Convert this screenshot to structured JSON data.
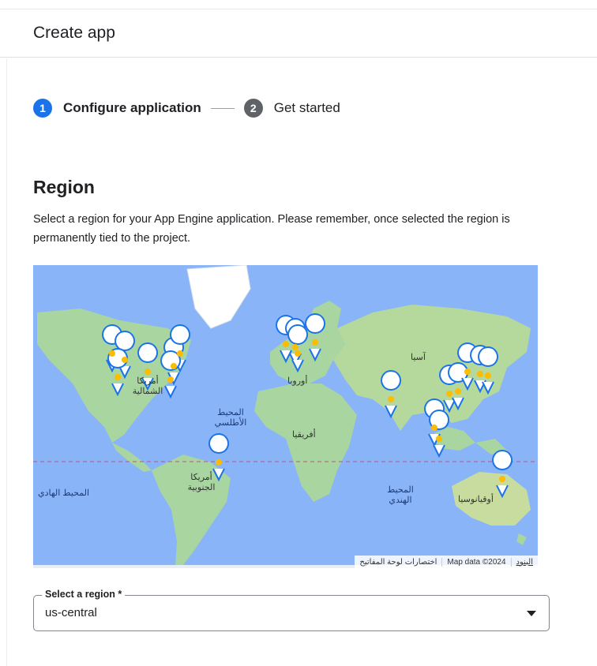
{
  "header": {
    "title": "Create app"
  },
  "stepper": {
    "steps": [
      {
        "number": "1",
        "label": "Configure application",
        "state": "active"
      },
      {
        "number": "2",
        "label": "Get started",
        "state": "inactive"
      }
    ]
  },
  "region": {
    "title": "Region",
    "description": "Select a region for your App Engine application. Please remember, once selected the region is permanently tied to the project."
  },
  "map": {
    "labels": {
      "north_america": "أمريكا الشمالية",
      "atlantic": "المحيط الأطلسي",
      "europe": "أوروبا",
      "asia": "آسيا",
      "africa": "أفريقيا",
      "south_america": "أمريكا الجنوبية",
      "pacific": "المحيط الهادي",
      "indian": "المحيط الهندي",
      "oceania": "أوقيانوسيا"
    },
    "attribution": {
      "shortcuts": "اختصارات لوحة المفاتيح",
      "map_data": "Map data ©2024",
      "terms": "البنود"
    },
    "marker_icon": "google-cloud-pin-icon",
    "colors": {
      "ocean": "#8ab4f8",
      "land": "#a8d5a0"
    }
  },
  "region_select": {
    "label": "Select a region *",
    "value": "us-central"
  }
}
